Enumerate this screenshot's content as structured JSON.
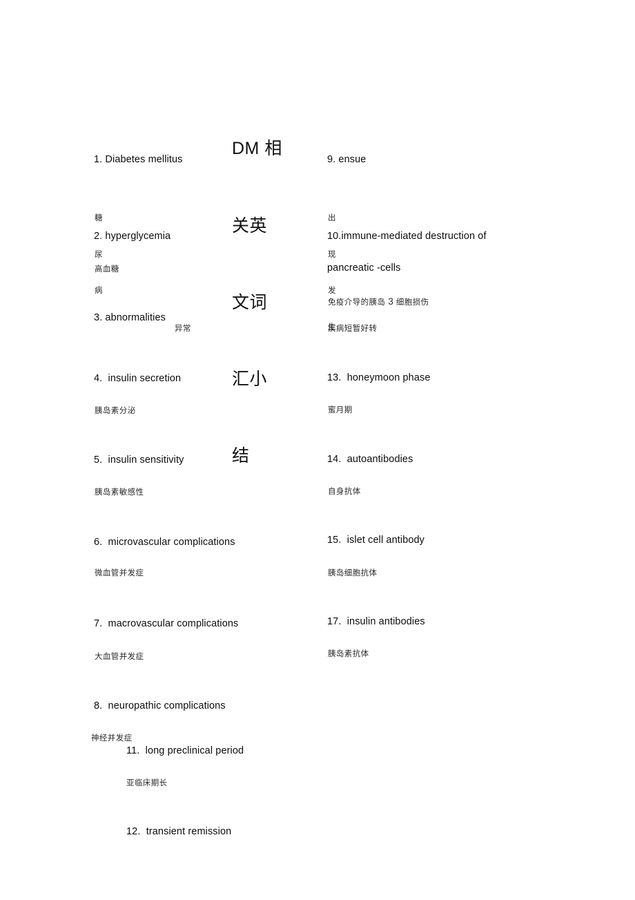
{
  "document": {
    "title_lines": [
      "DM 相",
      "关英",
      "文词",
      "汇小",
      "结"
    ],
    "title_plain": "DM 相关英文词汇小结",
    "page_background": "#ffffff",
    "text_color": "#0d0d0d",
    "gloss_color": "#2b2b2b"
  },
  "left_column": {
    "entries": [
      {
        "number": "1.",
        "term": "Diabetes mellitus",
        "heading": "1. Diabetes mellitus"
      },
      {
        "number": "2.",
        "term": "hyperglycemia",
        "heading": "2. hyperglycemia"
      },
      {
        "number": "3.",
        "term": "abnormalities",
        "heading": "3. abnormalities"
      },
      {
        "number": "4.",
        "term": "insulin secretion",
        "heading": "4.  insulin secretion"
      },
      {
        "number": "5.",
        "term": "insulin sensitivity",
        "heading": "5.  insulin sensitivity"
      },
      {
        "number": "6.",
        "term": "microvascular complications",
        "heading": "6.  microvascular complications"
      },
      {
        "number": "7.",
        "term": "macrovascular complications",
        "heading": "7.  macrovascular complications"
      },
      {
        "number": "8.",
        "term": "neuropathic complications",
        "heading": "8.  neuropathic complications"
      },
      {
        "number": "11.",
        "term": "long preclinical period",
        "heading": "11.  long preclinical period"
      },
      {
        "number": "12.",
        "term": "transient remission",
        "heading": "12.  transient remission"
      }
    ],
    "glosses": {
      "diabetes_mellitus_stack": [
        "糖",
        "尿",
        "病"
      ],
      "hyperglycemia": "高血糖",
      "abnormalities": "异常",
      "insulin_secretion": "胰岛素分泌",
      "insulin_sensitivity": "胰岛素敏感性",
      "microvascular": "微血管并发症",
      "macrovascular": "大血管并发症",
      "neuropathic": "神经并发症",
      "long_preclinical_period": "亚临床期长"
    }
  },
  "right_column": {
    "entries": [
      {
        "number": "9.",
        "term": "ensue",
        "heading": "9. ensue"
      },
      {
        "number": "10.",
        "term": "immune-mediated destruction of pancreatic -cells",
        "heading": "10.immune-mediated destruction of",
        "heading_line2": "pancreatic -cells"
      },
      {
        "number": "13.",
        "term": "honeymoon phase",
        "heading": "13.  honeymoon phase"
      },
      {
        "number": "14.",
        "term": "autoantibodies",
        "heading": "14.  autoantibodies"
      },
      {
        "number": "15.",
        "term": "islet cell antibody",
        "heading": "15.  islet cell antibody"
      },
      {
        "number": "17.",
        "term": "insulin antibodies",
        "heading": "17.  insulin antibodies"
      }
    ],
    "glosses": {
      "ensue_stack": [
        "出",
        "现",
        "发",
        "生"
      ],
      "immune_mediated_part1": "免疫介导的胰岛 ",
      "immune_mediated_symbol": "3",
      "immune_mediated_part2": " 细胞损伤",
      "transient_remission": "疾病短暂好转",
      "honeymoon_phase": "蜜月期",
      "autoantibodies": "自身抗体",
      "islet_cell_antibody": "胰岛细胞抗体",
      "insulin_antibodies": "胰岛素抗体"
    }
  }
}
